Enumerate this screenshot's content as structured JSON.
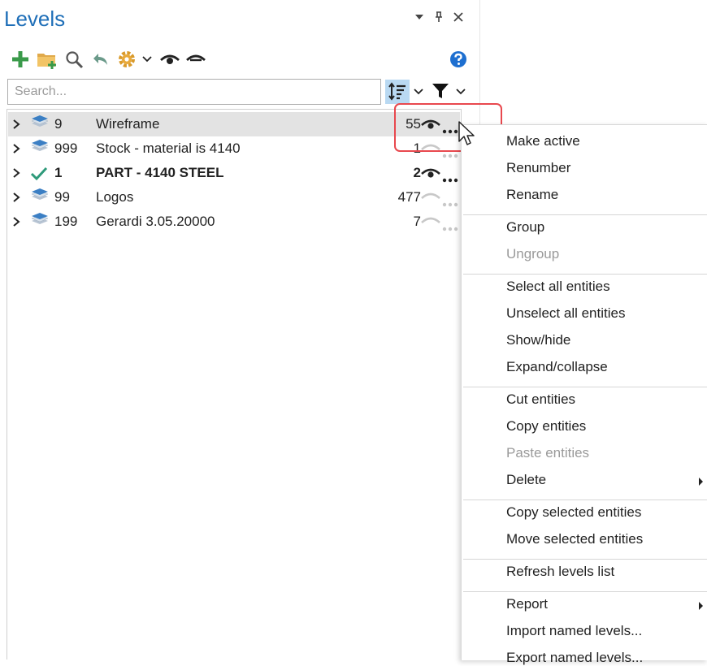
{
  "panel": {
    "title": "Levels",
    "search": {
      "placeholder": "Search...",
      "value": ""
    },
    "toolbar": {
      "icons": [
        "add-level-icon",
        "add-folder-icon",
        "find-icon",
        "undo-icon",
        "settings-icon",
        "settings-dropdown-icon",
        "show-all-icon",
        "hide-all-icon",
        "help-icon"
      ],
      "sort_icon": "sort-icon",
      "filter_icon": "filter-icon"
    }
  },
  "levels": [
    {
      "number": "9",
      "name": "Wireframe",
      "count": "55",
      "visible": true,
      "active": false,
      "selected": true
    },
    {
      "number": "999",
      "name": "Stock - material is 4140",
      "count": "1",
      "visible": false,
      "active": false,
      "selected": false
    },
    {
      "number": "1",
      "name": "PART - 4140 STEEL",
      "count": "2",
      "visible": true,
      "active": true,
      "selected": false
    },
    {
      "number": "99",
      "name": "Logos",
      "count": "477",
      "visible": false,
      "active": false,
      "selected": false
    },
    {
      "number": "199",
      "name": "Gerardi 3.05.20000",
      "count": "7",
      "visible": false,
      "active": false,
      "selected": false
    }
  ],
  "context_menu": {
    "groups": [
      [
        {
          "label": "Make active",
          "enabled": true
        },
        {
          "label": "Renumber",
          "enabled": true
        },
        {
          "label": "Rename",
          "enabled": true
        }
      ],
      [
        {
          "label": "Group",
          "enabled": true
        },
        {
          "label": "Ungroup",
          "enabled": false
        }
      ],
      [
        {
          "label": "Select all entities",
          "enabled": true
        },
        {
          "label": "Unselect all entities",
          "enabled": true
        },
        {
          "label": "Show/hide",
          "enabled": true
        },
        {
          "label": "Expand/collapse",
          "enabled": true
        }
      ],
      [
        {
          "label": "Cut entities",
          "enabled": true
        },
        {
          "label": "Copy entities",
          "enabled": true
        },
        {
          "label": "Paste entities",
          "enabled": false
        },
        {
          "label": "Delete",
          "enabled": true,
          "submenu": true
        }
      ],
      [
        {
          "label": "Copy selected entities",
          "enabled": true
        },
        {
          "label": "Move selected entities",
          "enabled": true
        }
      ],
      [
        {
          "label": "Refresh levels list",
          "enabled": true
        }
      ],
      [
        {
          "label": "Report",
          "enabled": true,
          "submenu": true
        },
        {
          "label": "Import named levels...",
          "enabled": true
        },
        {
          "label": "Export named levels...",
          "enabled": true
        }
      ]
    ]
  },
  "colors": {
    "accent": "#1f6fb8",
    "selected_row": "#e3e3e3",
    "highlight": "#e8484e",
    "sort_button": "#b9d9f2",
    "add_green": "#3a9a4a",
    "help_blue": "#1e6fd0",
    "active_check": "#2e9a7a"
  }
}
